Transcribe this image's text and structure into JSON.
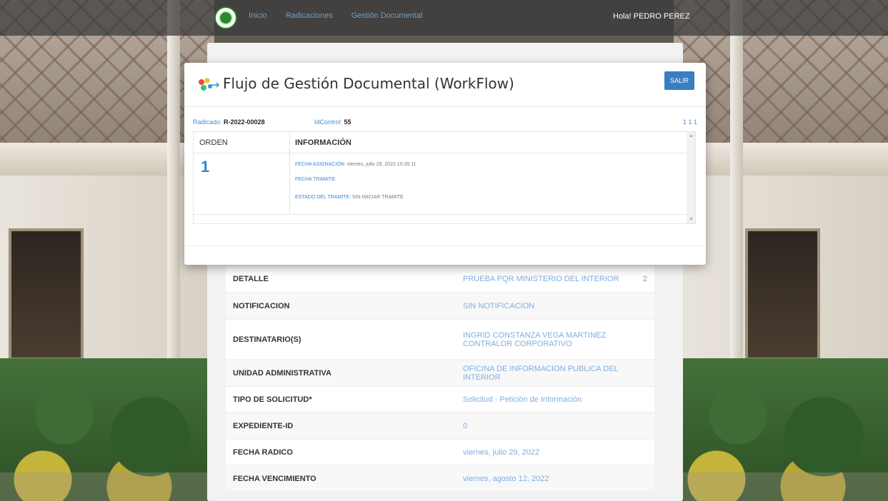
{
  "nav": {
    "links": [
      "Inicio",
      "Radicaciones",
      "Gestión Documental"
    ],
    "user_greeting": "Hola! PEDRO PEREZ"
  },
  "modal": {
    "title": "Flujo de Gestión Documental (WorkFlow)",
    "close_label": "SALIR",
    "radicado_label": "Radicado:",
    "radicado_value": "R-2022-00028",
    "idcontrol_label": "IdControl:",
    "idcontrol_value": "55",
    "pager": "1 1 1",
    "table": {
      "headers": [
        "ORDEN",
        "INFORMACIÓN"
      ],
      "rows": [
        {
          "orden": "1",
          "fecha_asignacion_label": "FECHA ASIGNACIÓN:",
          "fecha_asignacion_value": "viernes, julio 29, 2022 10:35:11",
          "fecha_tramite_label": "FECHA TRAMITE:",
          "fecha_tramite_value": "",
          "estado_label": "ESTADO DEL TRAMITE:",
          "estado_value": "SIN INICIAR TRAMITE"
        }
      ]
    }
  },
  "details": [
    {
      "label": "DETALLE",
      "value": "PRUEBA PQR MINISTERIO DEL INTERIOR",
      "suffix": "2"
    },
    {
      "label": "NOTIFICACION",
      "value": "SIN NOTIFICACION"
    },
    {
      "label": "DESTINATARIO(S)",
      "value": "INGRID CONSTANZA VEGA MARTINEZ\nCONTRALOR CORPORATIVO"
    },
    {
      "label": "UNIDAD ADMINISTRATIVA",
      "value": "OFICINA DE INFORMACION PUBLICA DEL INTERIOR"
    },
    {
      "label": "TIPO DE SOLICITUD*",
      "value": "Solicitud - Petición de Información"
    },
    {
      "label": "EXPEDIENTE-ID",
      "value": "0"
    },
    {
      "label": "FECHA RADICO",
      "value": "viernes, julio 29, 2022"
    },
    {
      "label": "FECHA VENCIMIENTO",
      "value": "viernes, agosto 12, 2022"
    }
  ],
  "colors": {
    "accent": "#3a7ec2",
    "link": "#4a8fd6",
    "navbar": "#373737"
  }
}
